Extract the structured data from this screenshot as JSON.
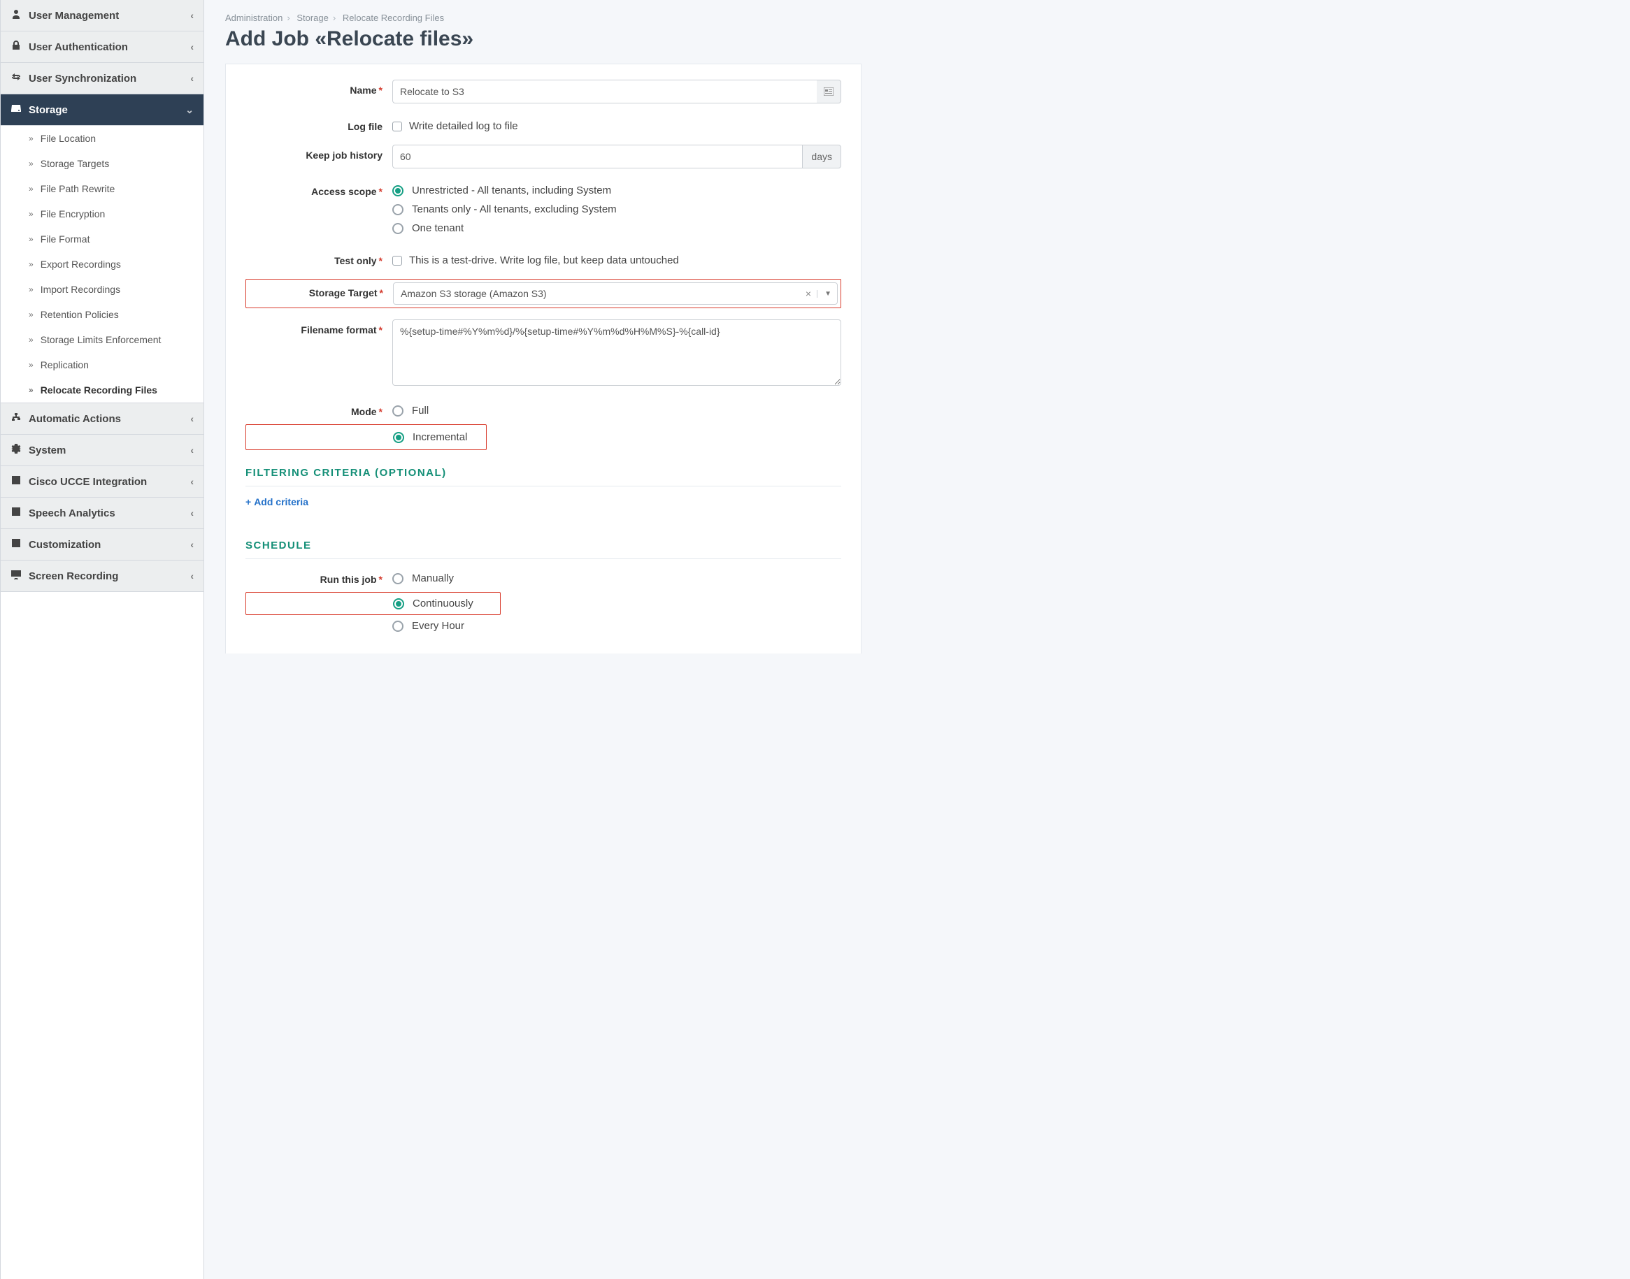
{
  "breadcrumb": [
    "Administration",
    "Storage",
    "Relocate Recording Files"
  ],
  "page_title": "Add Job «Relocate files»",
  "sidebar": {
    "items": [
      {
        "label": "User Management",
        "icon": "user",
        "collapsed": true
      },
      {
        "label": "User Authentication",
        "icon": "lock",
        "collapsed": true
      },
      {
        "label": "User Synchronization",
        "icon": "sync",
        "collapsed": true
      },
      {
        "label": "Storage",
        "icon": "disk",
        "collapsed": false,
        "active": true,
        "children": [
          {
            "label": "File Location"
          },
          {
            "label": "Storage Targets"
          },
          {
            "label": "File Path Rewrite"
          },
          {
            "label": "File Encryption"
          },
          {
            "label": "File Format"
          },
          {
            "label": "Export Recordings"
          },
          {
            "label": "Import Recordings"
          },
          {
            "label": "Retention Policies"
          },
          {
            "label": "Storage Limits Enforcement"
          },
          {
            "label": "Replication"
          },
          {
            "label": "Relocate Recording Files",
            "active": true
          }
        ]
      },
      {
        "label": "Automatic Actions",
        "icon": "sitemap",
        "collapsed": true
      },
      {
        "label": "System",
        "icon": "gear",
        "collapsed": true
      },
      {
        "label": "Cisco UCCE Integration",
        "icon": "check",
        "collapsed": true
      },
      {
        "label": "Speech Analytics",
        "icon": "check",
        "collapsed": true
      },
      {
        "label": "Customization",
        "icon": "check",
        "collapsed": true
      },
      {
        "label": "Screen Recording",
        "icon": "monitor",
        "collapsed": true
      }
    ]
  },
  "form": {
    "name_label": "Name",
    "name_value": "Relocate to S3",
    "logfile_label": "Log file",
    "logfile_check_text": "Write detailed log to file",
    "keep_label": "Keep job history",
    "keep_value": "60",
    "keep_unit": "days",
    "scope_label": "Access scope",
    "scope_options": [
      "Unrestricted - All tenants, including System",
      "Tenants only - All tenants, excluding System",
      "One tenant"
    ],
    "scope_selected": 0,
    "testonly_label": "Test only",
    "testonly_text": "This is a test-drive. Write log file, but keep data untouched",
    "target_label": "Storage Target",
    "target_value": "Amazon S3 storage (Amazon S3)",
    "filename_label": "Filename format",
    "filename_value": "%{setup-time#%Y%m%d}/%{setup-time#%Y%m%d%H%M%S}-%{call-id}",
    "mode_label": "Mode",
    "mode_options": [
      "Full",
      "Incremental"
    ],
    "mode_selected": 1,
    "filtering_title": "FILTERING CRITERIA (OPTIONAL)",
    "add_criteria_label": "Add criteria",
    "schedule_title": "SCHEDULE",
    "run_label": "Run this job",
    "run_options": [
      "Manually",
      "Continuously",
      "Every Hour"
    ],
    "run_selected": 1
  }
}
